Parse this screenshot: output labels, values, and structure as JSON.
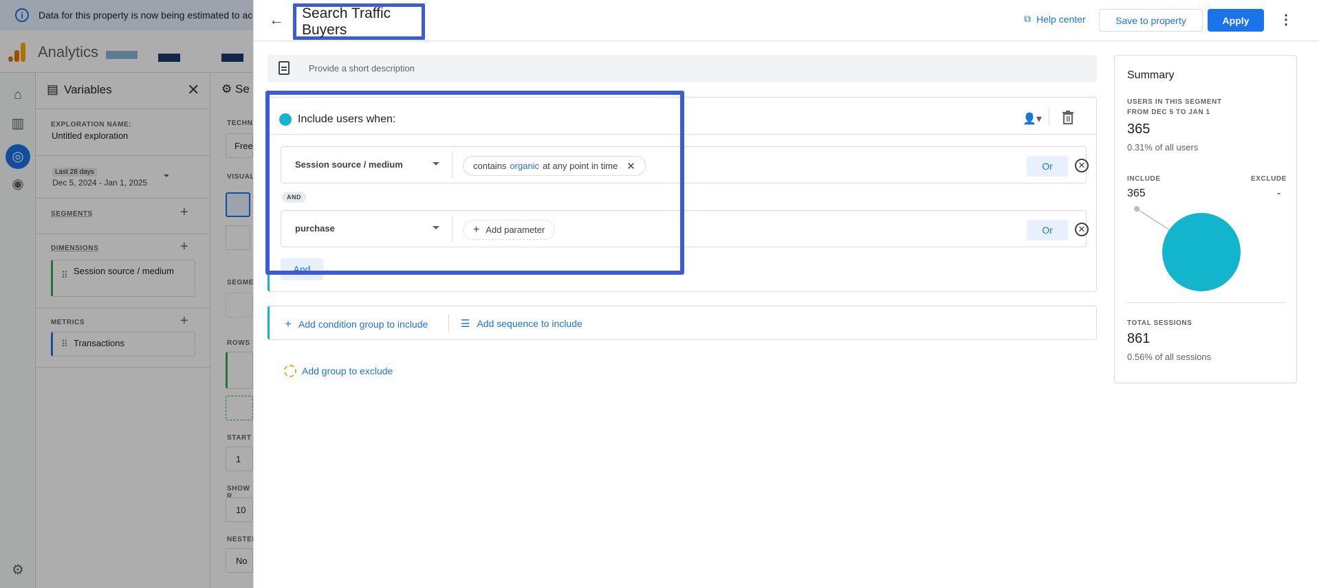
{
  "banner": {
    "text": "Data for this property is now being estimated to acc"
  },
  "app": {
    "title": "Analytics"
  },
  "variables": {
    "title": "Variables",
    "exploration_label": "EXPLORATION NAME:",
    "exploration_name": "Untitled exploration",
    "date_range_label": "Last 28 days",
    "date_range": "Dec 5, 2024 - Jan 1, 2025",
    "segments_label": "SEGMENTS",
    "dimensions_label": "DIMENSIONS",
    "dimension_item": "Session source / medium",
    "metrics_label": "METRICS",
    "metric_item": "Transactions"
  },
  "settings": {
    "tab_partial": "Se",
    "labels": [
      "TECHNI",
      "VISUAL",
      "SEGME",
      "ROWS",
      "START",
      "SHOW R",
      "NESTED"
    ],
    "technique_value": "Free",
    "start_value": "1",
    "show_value": "10",
    "nested_value": "No"
  },
  "dialog": {
    "title": "Search Traffic Buyers",
    "help_center": "Help center",
    "save_to_property": "Save to property",
    "apply": "Apply",
    "description_placeholder": "Provide a short description",
    "include_label": "Include users when:",
    "conditions": [
      {
        "dimension": "Session source / medium",
        "filter_prefix": "contains",
        "filter_keyword": "organic",
        "filter_suffix": "at any point in time",
        "or": "Or"
      },
      {
        "dimension": "purchase",
        "add_parameter": "Add parameter",
        "or": "Or"
      }
    ],
    "and_tag": "AND",
    "and_button": "And",
    "add_condition_group": "Add condition group to include",
    "add_sequence": "Add sequence to include",
    "add_group_exclude": "Add group to exclude"
  },
  "summary": {
    "title": "Summary",
    "users_label_1": "USERS IN THIS SEGMENT",
    "users_label_2": "FROM DEC 5 TO JAN 1",
    "users_value": "365",
    "users_pct": "0.31% of all users",
    "include_label": "INCLUDE",
    "exclude_label": "EXCLUDE",
    "include_value": "365",
    "exclude_value": "-",
    "sessions_label": "TOTAL SESSIONS",
    "sessions_value": "861",
    "sessions_pct": "0.56% of all sessions",
    "pie_color": "#12b5cb"
  },
  "colors": {
    "accent": "#1a73e8",
    "highlight": "#3c5bd9",
    "segment": "#12b5cb"
  }
}
